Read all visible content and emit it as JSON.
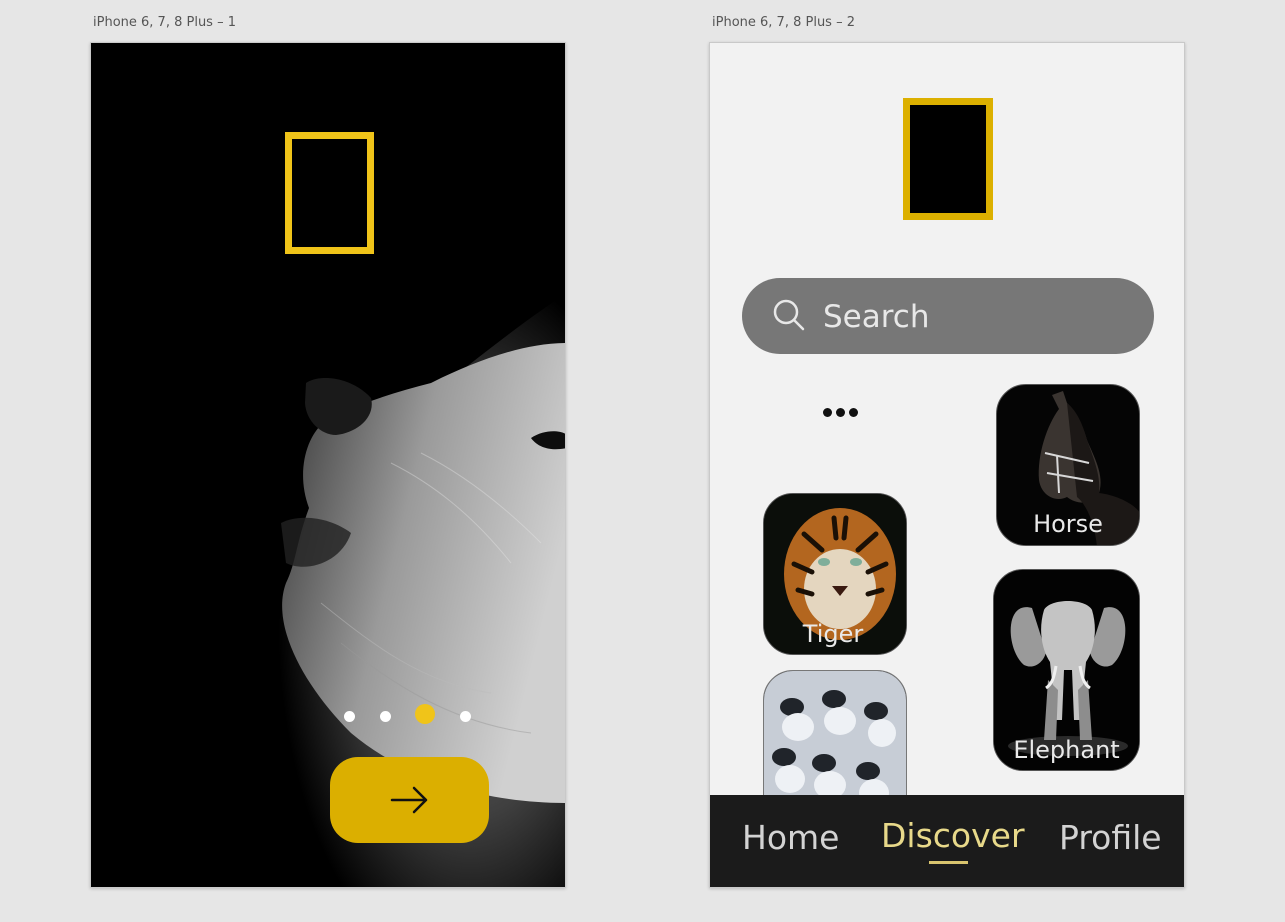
{
  "artboards": [
    {
      "label": "iPhone 6, 7, 8 Plus – 1"
    },
    {
      "label": "iPhone 6, 7, 8 Plus – 2"
    }
  ],
  "screen1": {
    "pager": {
      "count": 4,
      "active_index": 2,
      "active_color": "#f0c419"
    },
    "next_button_icon": "arrow-right-icon",
    "accent_color": "#dbaf00"
  },
  "screen2": {
    "search": {
      "placeholder": "Search",
      "icon": "search-icon"
    },
    "more_icon": "more-horizontal-icon",
    "cards": [
      {
        "label": "Horse"
      },
      {
        "label": "Tiger"
      },
      {
        "label": ""
      },
      {
        "label": "Elephant"
      }
    ],
    "nav": {
      "items": [
        {
          "label": "Home"
        },
        {
          "label": "Discover"
        },
        {
          "label": "Profile"
        }
      ],
      "active": "Discover",
      "active_color": "#e8d98a"
    }
  }
}
